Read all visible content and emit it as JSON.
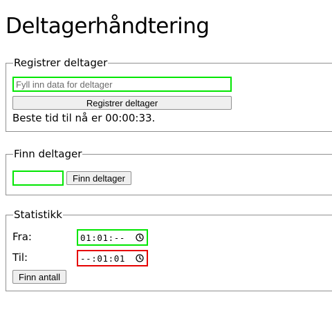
{
  "page": {
    "title": "Deltagerhåndtering"
  },
  "register": {
    "legend": "Registrer deltager",
    "input_placeholder": "Fyll inn data for deltager",
    "input_value": "",
    "button_label": "Registrer deltager",
    "best_time_text": "Beste tid til nå er 00:00:33."
  },
  "find": {
    "legend": "Finn deltager",
    "input_value": "",
    "button_label": "Finn deltager"
  },
  "stats": {
    "legend": "Statistikk",
    "from_label": "Fra:",
    "from_value": "01:01:--",
    "to_label": "Til:",
    "to_value": "--:01:01",
    "button_label": "Finn antall"
  },
  "colors": {
    "valid_border": "#00e600",
    "invalid_border": "#e60000"
  },
  "icons": {
    "time_picker": "clock-icon"
  }
}
